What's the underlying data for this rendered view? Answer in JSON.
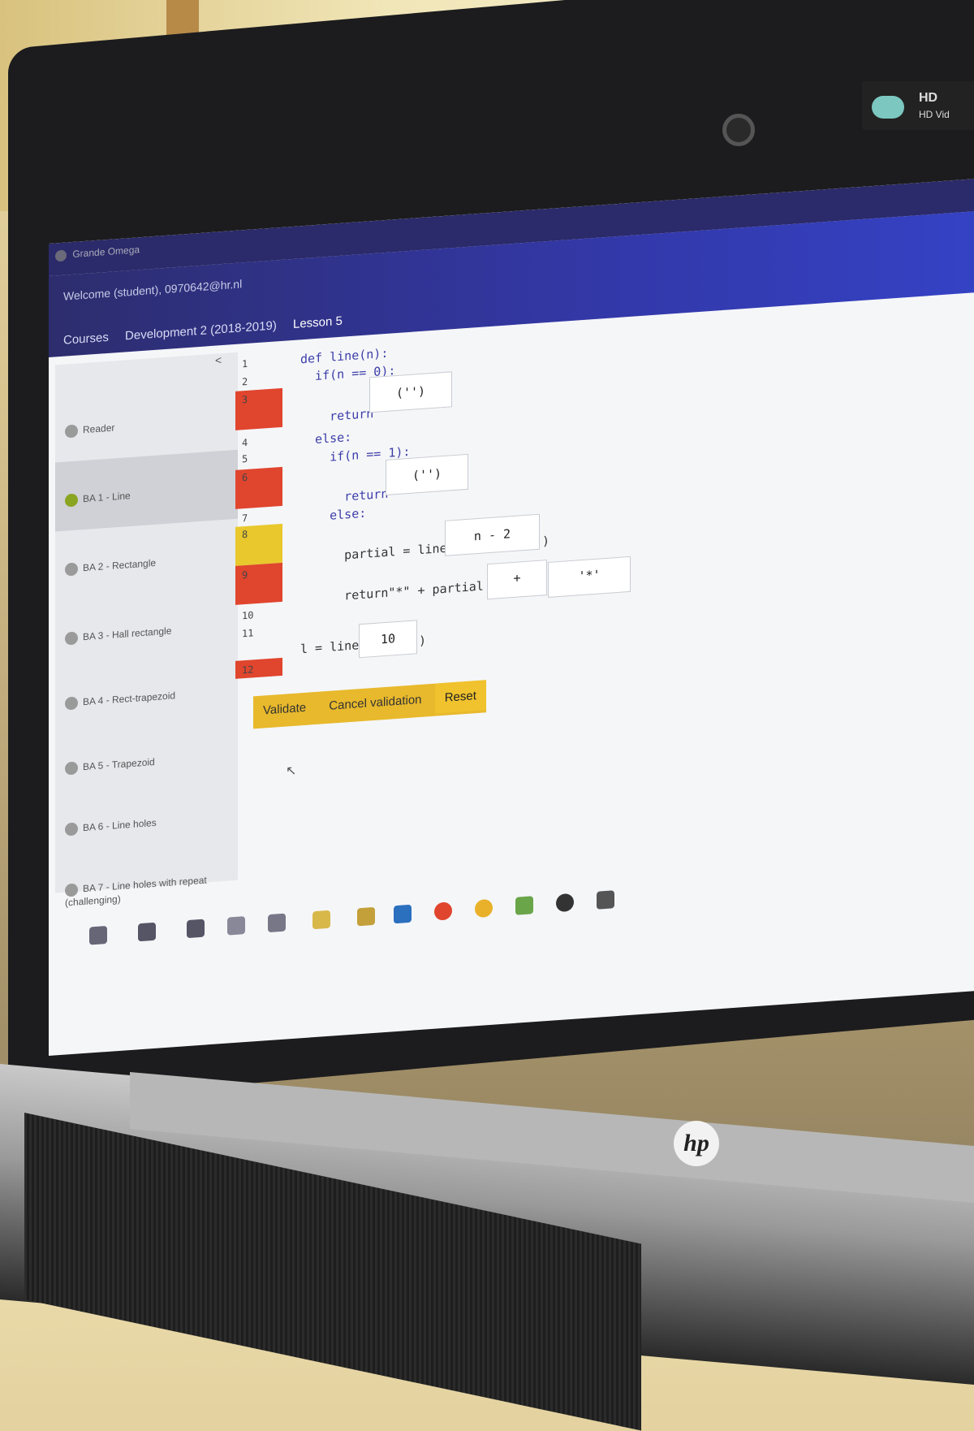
{
  "bezel": {
    "hd_label_1": "HD",
    "hd_label_2": "HD Vid"
  },
  "app": {
    "brand": "Grande Omega",
    "welcome": "Welcome (student), 0970642@hr.nl"
  },
  "breadcrumbs": [
    "Courses",
    "Development 2 (2018-2019)",
    "Lesson 5"
  ],
  "sidebar": {
    "collapse_icon": "chevron-left-icon",
    "items": [
      {
        "label": "Reader",
        "status": "grey"
      },
      {
        "label": "BA 1 - Line",
        "status": "green",
        "active": true
      },
      {
        "label": "BA 2 - Rectangle",
        "status": "grey"
      },
      {
        "label": "BA 3 - Hall rectangle",
        "status": "grey"
      },
      {
        "label": "BA 4 - Rect-trapezoid",
        "status": "grey"
      },
      {
        "label": "BA 5 - Trapezoid",
        "status": "grey"
      },
      {
        "label": "BA 6 - Line holes",
        "status": "grey"
      },
      {
        "label": "BA 7 - Line holes with repeat (challenging)",
        "status": "grey"
      }
    ]
  },
  "line_numbers": [
    "1",
    "2",
    "3",
    "4",
    "5",
    "6",
    "7",
    "8",
    "9",
    "10",
    "11",
    "12"
  ],
  "code": {
    "l1": "def line(n):",
    "l2": "  if(n == 0):",
    "l3": "    return",
    "l4": "  else:",
    "l5": "    if(n == 1):",
    "l6": "      return",
    "l7": "    else:",
    "l8": "      partial = line",
    "l9": "      return\"*\" + partial",
    "l10": "l = line",
    "slot_return_1": "('')",
    "slot_return_2": "('')",
    "slot_partial_arg": "n - 2",
    "slot_plus": "+",
    "slot_star": "'*'",
    "slot_line_arg": "10",
    "close_paren": ")"
  },
  "buttons": {
    "validate": "Validate",
    "cancel": "Cancel validation",
    "reset": "Reset"
  },
  "colors": {
    "error": "#e0452e",
    "warning": "#e8c82c",
    "header": "#2d2d6e",
    "accent": "#e8b92c"
  },
  "logo": "hp"
}
